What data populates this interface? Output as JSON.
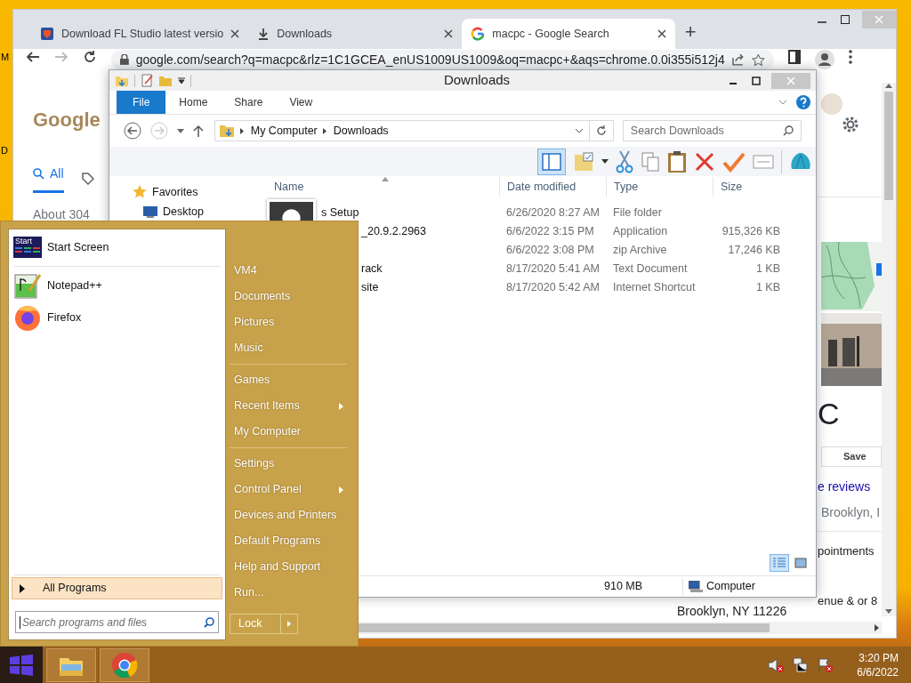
{
  "desktop": {
    "labels": [
      "M",
      "D"
    ]
  },
  "browser": {
    "tabs": [
      {
        "title": "Download FL Studio latest versio",
        "kind": "site",
        "selected": false
      },
      {
        "title": "Downloads",
        "kind": "download",
        "selected": false
      },
      {
        "title": "macpc - Google Search",
        "kind": "google",
        "selected": true
      }
    ],
    "new_tab": "+",
    "address": "google.com/search?q=macpc&rlz=1C1GCEA_enUS1009US1009&oq=macpc+&aqs=chrome.0.0i355i512j4",
    "logo": "Google",
    "search_tabs": [
      {
        "label": "All",
        "selected": true
      }
    ],
    "result_count": "About 304",
    "side_panel": {
      "title": "C",
      "save": "Save",
      "reviews": "e reviews",
      "address": "Brooklyn, I",
      "hours": "pointments",
      "service": "enue & or 8"
    },
    "footer_address": "Brooklyn, NY 11226"
  },
  "explorer": {
    "title": "Downloads",
    "ribbon_tabs": [
      {
        "label": "File",
        "selected": true
      },
      {
        "label": "Home",
        "selected": false
      },
      {
        "label": "Share",
        "selected": false
      },
      {
        "label": "View",
        "selected": false
      }
    ],
    "breadcrumbs": [
      "My Computer",
      "Downloads"
    ],
    "search": {
      "placeholder": "Search Downloads"
    },
    "nav": [
      {
        "label": "Favorites",
        "kind": "star"
      },
      {
        "label": "Desktop",
        "kind": "desktop"
      }
    ],
    "columns": [
      "Name",
      "Date modified",
      "Type",
      "Size"
    ],
    "rows": [
      {
        "name": "s Setup",
        "date": "6/26/2020 8:27 AM",
        "type": "File folder"
      },
      {
        "name": "_20.9.2.2963",
        "date": "6/6/2022 3:15 PM",
        "type": "Application",
        "size": "915,326 KB"
      },
      {
        "date": "6/6/2022 3:08 PM",
        "type": "zip Archive",
        "size": "17,246 KB"
      },
      {
        "name": "rack",
        "date": "8/17/2020 5:41 AM",
        "type": "Text Document",
        "size": "1 KB"
      },
      {
        "name": "site",
        "date": "8/17/2020 5:42 AM",
        "type": "Internet Shortcut",
        "size": "1 KB"
      }
    ],
    "view_modes": [
      {
        "kind": "details",
        "selected": true
      },
      {
        "kind": "large",
        "selected": false
      }
    ],
    "status": {
      "free_space": "910 MB",
      "location": "Computer"
    }
  },
  "start_menu": {
    "pinned": [
      {
        "label": "Start Screen",
        "kind": "start",
        "badge": "Start"
      },
      {
        "label": "Notepad++",
        "kind": "notepad"
      },
      {
        "label": "Firefox",
        "kind": "firefox"
      }
    ],
    "all_programs": "All Programs",
    "search": {
      "placeholder": "Search programs and files"
    },
    "places": [
      [
        {
          "label": "VM4",
          "submenu": false
        },
        {
          "label": "Documents",
          "submenu": false
        },
        {
          "label": "Pictures",
          "submenu": false
        },
        {
          "label": "Music",
          "submenu": false
        }
      ],
      [
        {
          "label": "Games",
          "submenu": false
        },
        {
          "label": "Recent Items",
          "submenu": true
        },
        {
          "label": "My Computer",
          "submenu": false
        }
      ],
      [
        {
          "label": "Settings",
          "submenu": false
        },
        {
          "label": "Control Panel",
          "submenu": true
        },
        {
          "label": "Devices and Printers",
          "submenu": false
        },
        {
          "label": "Default Programs",
          "submenu": false
        },
        {
          "label": "Help and Support",
          "submenu": false
        },
        {
          "label": "Run...",
          "submenu": false
        }
      ]
    ],
    "lock": "Lock"
  },
  "taskbar": {
    "apps": [
      {
        "kind": "explorer"
      },
      {
        "kind": "chrome"
      }
    ],
    "time": "3:20 PM",
    "date": "6/6/2022"
  }
}
